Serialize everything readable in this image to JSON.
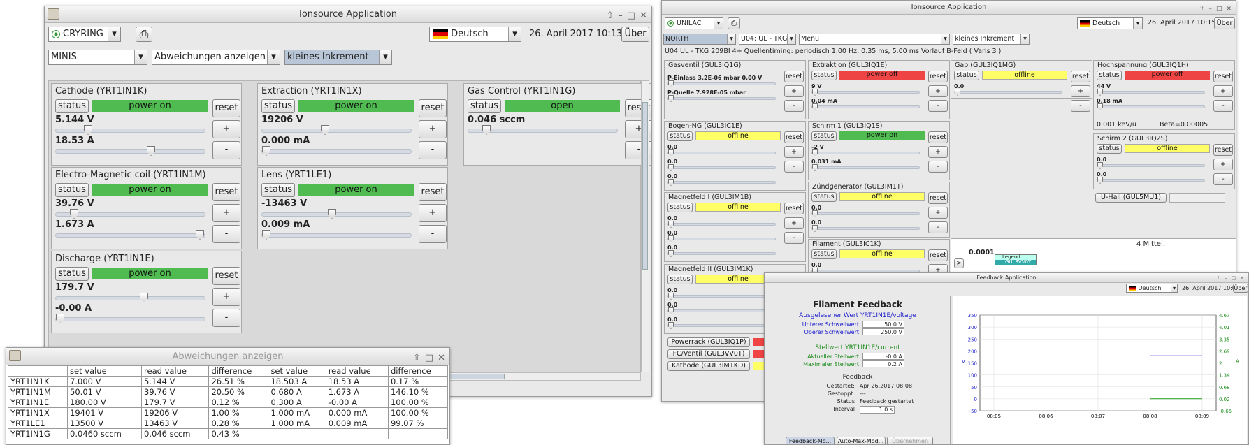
{
  "w1": {
    "title": "Ionsource Application",
    "ring": "CRYRING",
    "lang": "Deutsch",
    "date": "26. April 2017 10:13",
    "about": "Über",
    "c1": "MINIS",
    "c2": "Abweichungen anzeigen",
    "c3": "kleines Inkrement",
    "panels": [
      {
        "title": "Cathode (YRT1IN1K)",
        "status": "power on",
        "v1": "5.144 V",
        "v2": "18.53 A",
        "f1": 0.2,
        "f2": 0.65
      },
      {
        "title": "Extraction (YRT1IN1X)",
        "status": "power on",
        "v1": "19206 V",
        "v2": "0.000 mA",
        "f1": 0.42,
        "f2": 0.0
      },
      {
        "title": "Gas Control (YRT1IN1G)",
        "status": "open",
        "v1": "0.046 sccm",
        "f1": 0.1
      },
      {
        "title": "Electro-Magnetic coil (YRT1IN1M)",
        "status": "power on",
        "v1": "39.76 V",
        "v2": "1.673 A",
        "f1": 0.1,
        "f2": 1.0
      },
      {
        "title": "Lens (YRT1LE1)",
        "status": "power on",
        "v1": "-13463 V",
        "v2": "0.009 mA",
        "f1": 0.47,
        "f2": 0.0
      },
      {
        "title": "Discharge (YRT1IN1E)",
        "status": "power on",
        "v1": "179.7 V",
        "v2": "-0.00 A",
        "f1": 0.6,
        "f2": 0.0
      }
    ],
    "statusLabel": "status",
    "resetLabel": "reset",
    "plus": "+",
    "minus": "-"
  },
  "dev": {
    "title": "Abweichungen anzeigen",
    "headers": [
      "",
      "set value",
      "read value",
      "difference",
      "set value",
      "read value",
      "difference"
    ],
    "rows": [
      [
        "YRT1IN1K",
        "7.000 V",
        "5.144 V",
        "26.51 %",
        "18.503 A",
        "18.53 A",
        "0.17 %"
      ],
      [
        "YRT1IN1M",
        "50.01 V",
        "39.76 V",
        "20.50 %",
        "0.680 A",
        "1.673 A",
        "146.10 %"
      ],
      [
        "YRT1IN1E",
        "180.00 V",
        "179.7 V",
        "0.12 %",
        "0.300 A",
        "-0.00 A",
        "100.00 %"
      ],
      [
        "YRT1IN1X",
        "19401 V",
        "19206 V",
        "1.00 %",
        "1.000 mA",
        "0.000 mA",
        "100.00 %"
      ],
      [
        "YRT1LE1",
        "13500 V",
        "13463 V",
        "0.28 %",
        "1.000 mA",
        "0.009 mA",
        "99.07 %"
      ],
      [
        "YRT1IN1G",
        "0.0460 sccm",
        "0.046 sccm",
        "0.43 %",
        "",
        "",
        ""
      ]
    ]
  },
  "w2": {
    "title": "Ionsource Application",
    "ring": "UNILAC",
    "lang": "Deutsch",
    "date": "26. April 2017 10:15",
    "about": "Über",
    "c1": "NORTH",
    "c2": "U04: UL - TKG",
    "c3": "Menu",
    "c4": "kleines Inkrement",
    "info": "U04  UL - TKG  209BI 4+   Quellentiming: periodisch  1.00 Hz,  0.35 ms,  5.00 ms Vorlauf B-Feld   ( Varis 3 )",
    "gas": {
      "title": "Gasventil (GUL3IQ1G)",
      "l1": "P-Einlass 3.2E-06 mbar     0.00 V",
      "l2": "P-Quelle 7.928E-05 mbar"
    },
    "extr": {
      "title": "Extraktion (GUL3IQ1E)",
      "status": "power off",
      "v1": "9 V",
      "v2": "0.04 mA"
    },
    "gap": {
      "title": "Gap (GUL3IQ1MG)",
      "status": "offline",
      "v1": "0.0"
    },
    "hv": {
      "title": "Hochspannung (GUL3IQ1H)",
      "status": "power off",
      "v1": "44 V",
      "v2": "0.18 mA",
      "ev": "0.001 keV/u",
      "beta": "Beta=0.00005"
    },
    "bogen": {
      "title": "Bogen-NG (GUL3IC1E)",
      "status": "offline",
      "v": [
        "0.0",
        "0.0",
        "0.0"
      ]
    },
    "schirm1": {
      "title": "Schirm 1 (GUL3IQ1S)",
      "status": "power on",
      "v1": "-2 V",
      "v2": "0.031 mA"
    },
    "schirm2": {
      "title": "Schirm 2 (GUL3IQ2S)",
      "status": "offline",
      "v": [
        "0.0",
        "0.0"
      ]
    },
    "uhall": "U-Hall (GUL5MU1)",
    "mag1": {
      "title": "Magnetfeld I (GUL3IM1B)",
      "status": "offline",
      "v": [
        "0.0",
        "0.0",
        "0.0"
      ]
    },
    "zund": {
      "title": "Zündgenerator (GUL3IM1T)",
      "status": "offline",
      "v": [
        "0.0",
        "0.0"
      ]
    },
    "fil": {
      "title": "Filament (GUL3IC1K)",
      "status": "offline",
      "v": [
        "0.0"
      ]
    },
    "mag2": {
      "title": "Magnetfeld II (GUL3IM1K)",
      "status": "offline",
      "v": [
        "0.0",
        "0.0",
        "0.0"
      ]
    },
    "chartTitle": "4 Mittel.",
    "chartTick": "0.0001",
    "legendTitle": "Legend",
    "legendItem": "GUL3VV0T",
    "bottom": [
      "Powerrack (GUL3IQ1P)",
      "FC/Ventil (GUL3VV0T)",
      "Kathode (GUL3IM1KD)"
    ]
  },
  "fb": {
    "title": "Feedback Application",
    "lang": "Deutsch",
    "date": "26. April 2017 10:09",
    "about": "Über",
    "heading": "Filament Feedback",
    "readLabel": "Ausgelesener Wert",
    "readSig": "YRT1IN1E/voltage",
    "lowLabel": "Unterer Schwellwert",
    "lowVal": "50.0 V",
    "highLabel": "Oberer Schwellwert",
    "highVal": "250.0 V",
    "setLabel": "Stellwert",
    "setSig": "YRT1IN1E/current",
    "curLabel": "Aktueller Stellwert",
    "curVal": "-0.0 A",
    "maxLabel": "Maximaler Stellwert",
    "maxVal": "0.2 A",
    "fbHead": "Feedback",
    "rows": [
      [
        "Gestartet:",
        "Apr 26,2017 08:08"
      ],
      [
        "Gestoppt:",
        "---"
      ],
      [
        "Status",
        "Feedback gestartet"
      ],
      [
        "Interval",
        "1.0 s"
      ]
    ],
    "buttons": [
      "Feedback-Mo...",
      "Auto-Max-Mod...",
      "Übernehmen"
    ]
  },
  "chart_data": {
    "type": "line",
    "x": [
      "08:05",
      "08:06",
      "08:07",
      "08:08",
      "08:09"
    ],
    "yleft_ticks": [
      350,
      300,
      250,
      200,
      150,
      100,
      50,
      0,
      -50
    ],
    "yright_ticks": [
      "4.67",
      "4.01",
      "3.35",
      "2.69",
      "2",
      "1.34",
      "0.68",
      "0.02",
      "-0.65"
    ],
    "ylabel_left": "V",
    "ylabel_right": "A",
    "series": [
      {
        "color": "#2a2ad0",
        "x": [
          "08:08",
          "08:09"
        ],
        "y": [
          180,
          180
        ]
      },
      {
        "color": "#1a9a1a",
        "x": [
          "08:08",
          "08:09"
        ],
        "y": [
          0.02,
          0.02
        ]
      }
    ]
  }
}
